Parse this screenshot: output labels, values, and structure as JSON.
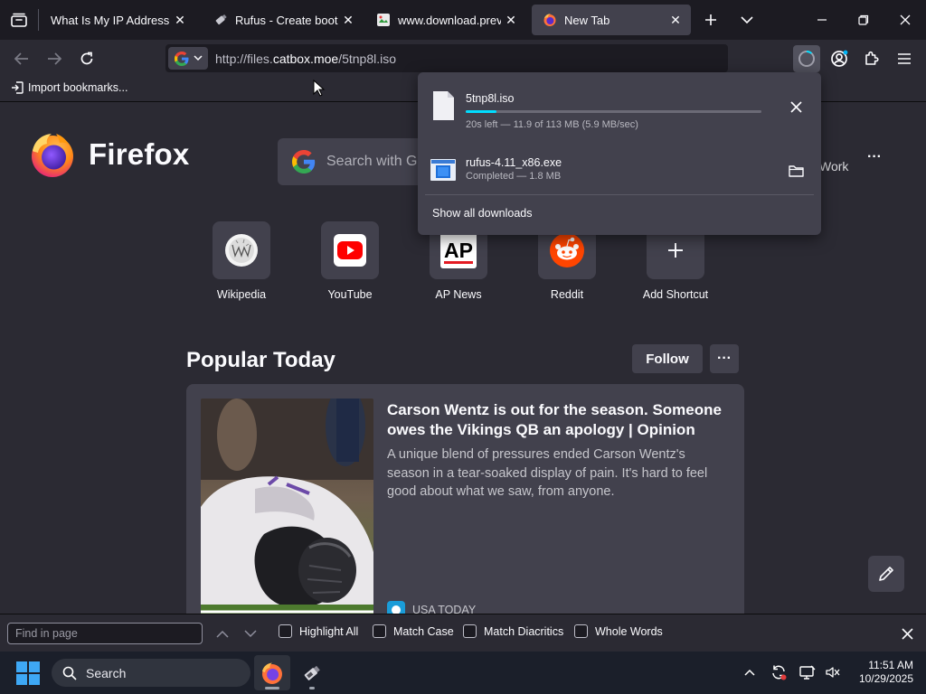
{
  "tabs": [
    {
      "title": "What Is My IP Address - See",
      "active": false
    },
    {
      "title": "Rufus - Create bootable",
      "active": false
    },
    {
      "title": "www.download.previous",
      "active": false
    },
    {
      "title": "New Tab",
      "active": true
    }
  ],
  "navbar": {
    "url_prefix": "http://files.",
    "url_domain": "catbox.moe",
    "url_path": "/5tnp8l.iso"
  },
  "bookmarks": {
    "import_label": "Import bookmarks..."
  },
  "newtab": {
    "brand": "Firefox",
    "search_placeholder": "Search with Google or enter address",
    "work_label": "Work",
    "shortcuts": [
      {
        "label": "Wikipedia"
      },
      {
        "label": "YouTube"
      },
      {
        "label": "AP News"
      },
      {
        "label": "Reddit"
      },
      {
        "label": "Add Shortcut"
      }
    ],
    "section_title": "Popular Today",
    "follow_label": "Follow",
    "story": {
      "headline": "Carson Wentz is out for the season. Someone owes the Vikings QB an apology | Opinion",
      "excerpt": "A unique blend of pressures ended Carson Wentz's season in a tear-soaked display of pain. It's hard to feel good about what we saw, from anyone.",
      "source": "USA TODAY"
    }
  },
  "downloads": {
    "items": [
      {
        "name": "5tnp8l.iso",
        "status": "20s left — 11.9 of 113 MB (5.9 MB/sec)",
        "progress": 0.105
      },
      {
        "name": "rufus-4.11_x86.exe",
        "status": "Completed — 1.8 MB"
      }
    ],
    "show_all": "Show all downloads"
  },
  "findbar": {
    "placeholder": "Find in page",
    "options": [
      "Highlight All",
      "Match Case",
      "Match Diacritics",
      "Whole Words"
    ]
  },
  "taskbar": {
    "search_label": "Search",
    "time": "11:51 AM",
    "date": "10/29/2025"
  },
  "colors": {
    "accent": "#00ddff",
    "tabstrip": "#1c1b22",
    "surface": "#2b2a33",
    "card": "#42414d"
  }
}
